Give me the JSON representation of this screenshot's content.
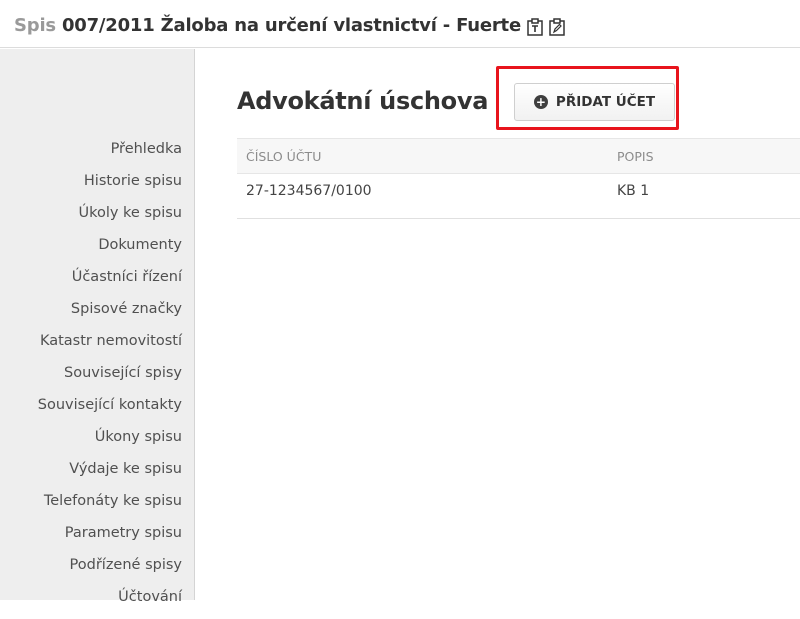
{
  "header": {
    "prefix": "Spis",
    "title": "007/2011 Žaloba na určení vlastnictví - Fuerte"
  },
  "sidebar": {
    "items": [
      "Přehledka",
      "Historie spisu",
      "Úkoly ke spisu",
      "Dokumenty",
      "Účastníci řízení",
      "Spisové značky",
      "Katastr nemovitostí",
      "Související spisy",
      "Související kontakty",
      "Úkony spisu",
      "Výdaje ke spisu",
      "Telefonáty ke spisu",
      "Parametry spisu",
      "Podřízené spisy",
      "Účtování"
    ]
  },
  "main": {
    "title": "Advokátní úschova",
    "add_button_label": "PŘIDAT ÚČET",
    "table": {
      "headers": [
        "ČÍSLO ÚČTU",
        "POPIS"
      ],
      "rows": [
        [
          "27-1234567/0100",
          "KB 1"
        ]
      ]
    }
  },
  "colors": {
    "highlight": "#e8141c",
    "sidebar_bg": "#eeeeee"
  },
  "icons": {
    "header_icon_1": "clipboard-text-icon",
    "header_icon_2": "clipboard-edit-icon",
    "add_button_icon": "plus-circle-icon"
  }
}
